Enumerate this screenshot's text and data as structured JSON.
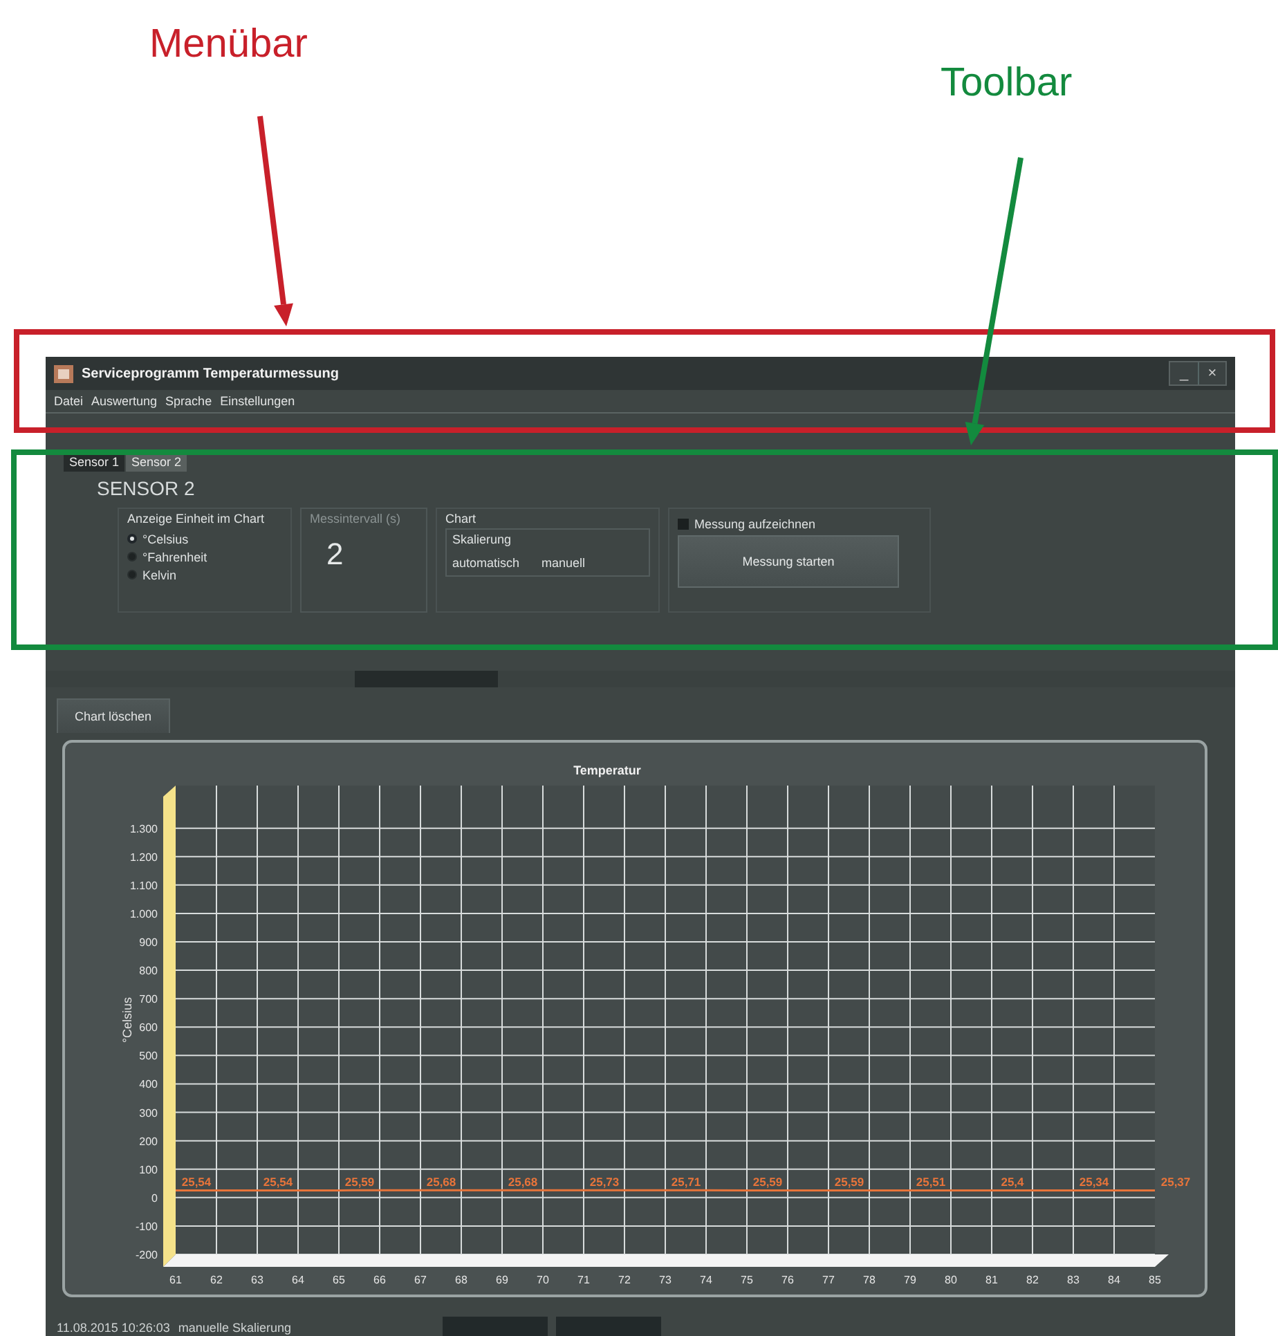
{
  "annotations": [
    {
      "label": "Menübar",
      "color": "#c8202a"
    },
    {
      "label": "Toolbar",
      "color": "#138a3e"
    }
  ],
  "window": {
    "title": "Serviceprogramm Temperaturmessung",
    "controls": [
      "_",
      "×"
    ]
  },
  "menu": [
    "Datei",
    "Auswertung",
    "Sprache",
    "Einstellungen"
  ],
  "sensor_tabs": [
    {
      "label": "Sensor 1",
      "selected": false
    },
    {
      "label": "Sensor 2",
      "selected": true
    }
  ],
  "sensor_heading": "SENSOR 2",
  "unit_group": {
    "title": "Anzeige Einheit im Chart",
    "options": [
      {
        "label": "°Celsius",
        "selected": true
      },
      {
        "label": "°Fahrenheit",
        "selected": false
      },
      {
        "label": "Kelvin",
        "selected": false
      }
    ]
  },
  "interval": {
    "label": "Messintervall (s)",
    "disabled": true,
    "value": "2"
  },
  "chart_group": {
    "title": "Chart",
    "scaling": {
      "title": "Skalierung",
      "buttons": [
        "automatisch",
        "manuell"
      ]
    }
  },
  "record": {
    "label": "Messung aufzeichnen",
    "checked": false
  },
  "start_button": "Messung starten",
  "clear_button": "Chart löschen",
  "chart": {
    "chart_data": {
      "type": "line",
      "title": "Temperatur",
      "ylabel": "°Celsius",
      "x": [
        61,
        63,
        65,
        67,
        69,
        71,
        73,
        75,
        77,
        79,
        81,
        83,
        85
      ],
      "series": [
        {
          "color": "#e8743a",
          "values": [
            25.54,
            25.54,
            25.59,
            25.68,
            25.68,
            25.73,
            25.71,
            25.59,
            25.59,
            25.51,
            25.4,
            25.34,
            25.37
          ]
        }
      ],
      "value_labels": [
        "25,54",
        "25,54",
        "25,59",
        "25,68",
        "25,68",
        "25,73",
        "25,71",
        "25,59",
        "25,59",
        "25,51",
        "25,4",
        "25,34",
        "25,37"
      ],
      "xlim": [
        61,
        85
      ],
      "ylim": [
        -200,
        1450
      ],
      "grid": true,
      "xticks": [
        61,
        62,
        63,
        64,
        65,
        66,
        67,
        68,
        69,
        70,
        71,
        72,
        73,
        74,
        75,
        76,
        77,
        78,
        79,
        80,
        81,
        82,
        83,
        84,
        85
      ],
      "yticks": [
        {
          "value": 1300,
          "label": "1.300"
        },
        {
          "value": 1200,
          "label": "1.200"
        },
        {
          "value": 1100,
          "label": "1.100"
        },
        {
          "value": 1000,
          "label": "1.000"
        },
        {
          "value": 900,
          "label": "900"
        },
        {
          "value": 800,
          "label": "800"
        },
        {
          "value": 700,
          "label": "700"
        },
        {
          "value": 600,
          "label": "600"
        },
        {
          "value": 500,
          "label": "500"
        },
        {
          "value": 400,
          "label": "400"
        },
        {
          "value": 300,
          "label": "300"
        },
        {
          "value": 200,
          "label": "200"
        },
        {
          "value": 100,
          "label": "100"
        },
        {
          "value": 0,
          "label": "0"
        },
        {
          "value": -100,
          "label": "-100"
        },
        {
          "value": -200,
          "label": "-200"
        }
      ]
    }
  },
  "status_bar": {
    "timestamp": "11.08.2015 10:26:03",
    "message": "manuelle Skalierung"
  }
}
